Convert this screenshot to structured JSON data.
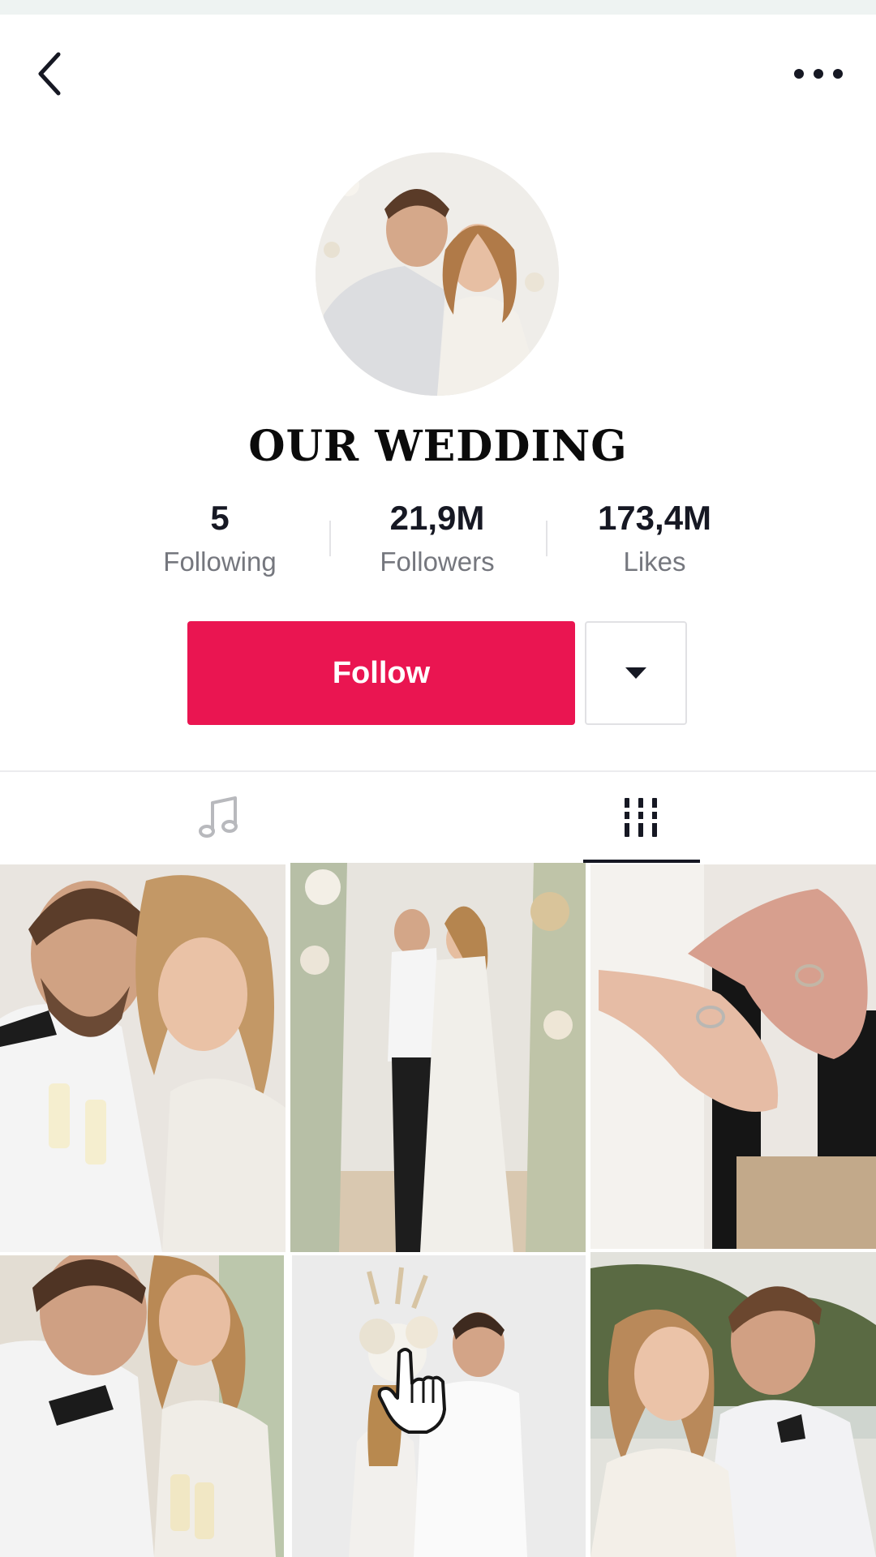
{
  "header": {
    "back_icon": "chevron-left-icon",
    "more_icon": "more-horizontal-icon"
  },
  "profile": {
    "name": "OUR WEDDING",
    "avatar": "couple-embrace-photo"
  },
  "stats": [
    {
      "value": "5",
      "label": "Following"
    },
    {
      "value": "21,9M",
      "label": "Followers"
    },
    {
      "value": "173,4M",
      "label": "Likes"
    }
  ],
  "actions": {
    "follow_label": "Follow",
    "dropdown_icon": "caret-down-icon"
  },
  "tabs": [
    {
      "icon": "music-note-icon",
      "active": false
    },
    {
      "icon": "grid-columns-icon",
      "active": true
    }
  ],
  "videos": [
    {
      "subject": "couple toasting champagne"
    },
    {
      "subject": "couple embracing at floral arch on beach"
    },
    {
      "subject": "hands holding wedding rings"
    },
    {
      "subject": "couple with champagne glasses"
    },
    {
      "subject": "couple kissing behind bouquet"
    },
    {
      "subject": "couple smiling outdoors"
    }
  ],
  "colors": {
    "accent": "#ea1551",
    "text": "#161823",
    "secondary_text": "#75777e"
  }
}
